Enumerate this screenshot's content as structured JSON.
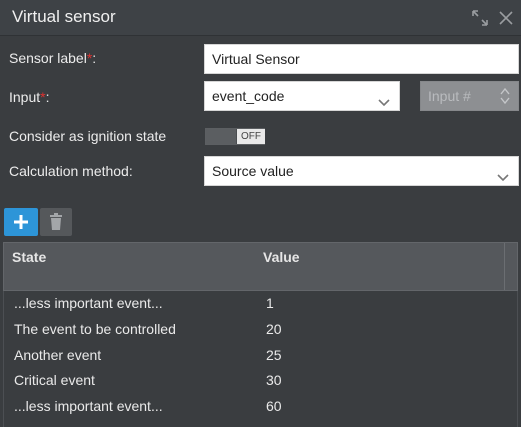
{
  "window": {
    "title": "Virtual sensor"
  },
  "form": {
    "sensor_label": {
      "label": "Sensor label",
      "required_mark": "*",
      "suffix": ":",
      "value": "Virtual Sensor"
    },
    "input": {
      "label": "Input",
      "required_mark": "*",
      "suffix": ":",
      "value": "event_code",
      "number_placeholder": "Input #"
    },
    "ignition": {
      "label": "Consider as ignition state",
      "toggle_text": "OFF"
    },
    "calculation": {
      "label": "Calculation method:",
      "value": "Source value"
    }
  },
  "table": {
    "headers": {
      "state": "State",
      "value": "Value"
    },
    "rows": [
      {
        "state": "...less important event...",
        "value": "1"
      },
      {
        "state": "The event to be controlled",
        "value": "20"
      },
      {
        "state": "Another event",
        "value": "25"
      },
      {
        "state": "Critical event",
        "value": "30"
      },
      {
        "state": "...less important event...",
        "value": "60"
      }
    ]
  },
  "colors": {
    "background": "#3a3d40",
    "accent": "#2d95d8",
    "required": "#e0312f"
  },
  "icons": {
    "expand": "expand-icon",
    "close": "close-icon",
    "add": "plus-icon",
    "delete": "trash-icon",
    "dropdown": "chevron-down-icon"
  }
}
